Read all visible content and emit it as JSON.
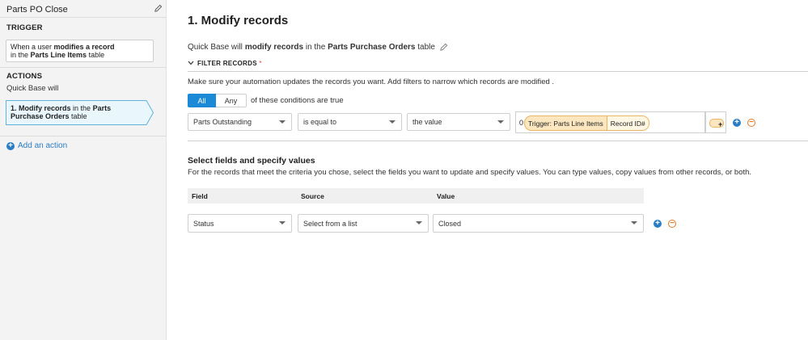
{
  "sidebar": {
    "title": "Parts PO Close",
    "trigger_label": "TRIGGER",
    "trigger": {
      "prefix": "When a user ",
      "action": "modifies a record",
      "line2_prefix": "in the ",
      "table": "Parts Line Items",
      "suffix": " table"
    },
    "actions_label": "ACTIONS",
    "actions_sub": "Quick Base will",
    "action_item": {
      "number": "1. Modify records",
      "middle": " in the ",
      "table": "Parts Purchase Orders",
      "suffix": " table"
    },
    "add_action": "Add an action"
  },
  "main": {
    "title": "1. Modify records",
    "qb_prefix": "Quick Base will ",
    "qb_action": "modify records",
    "qb_middle": " in the ",
    "qb_table": "Parts Purchase Orders",
    "qb_suffix": " table",
    "filter_header": "FILTER RECORDS",
    "filter_required": " *",
    "make_sure": "Make sure your automation updates the records you want. Add filters to narrow which records are modified .",
    "toggle_all": "All",
    "toggle_any": "Any",
    "conditions_text": "of these conditions are true",
    "filter_row": {
      "field": "Parts Outstanding",
      "operator": "is equal to",
      "value_type": "the value",
      "value_prefix": "0",
      "pill_source": "Trigger: Parts Line Items",
      "pill_field": "Record ID#",
      "insert_symbol": "+"
    },
    "section_title": "Select fields and specify values",
    "section_desc": "For the records that meet the criteria you chose, select the fields you want to update and specify values. You can type values, copy values from other records, or both.",
    "table_headers": [
      "Field",
      "Source",
      "Value"
    ],
    "value_row": {
      "field": "Status",
      "source": "Select from a list",
      "value": "Closed"
    },
    "add_symbol": "+",
    "remove_symbol": "−"
  }
}
